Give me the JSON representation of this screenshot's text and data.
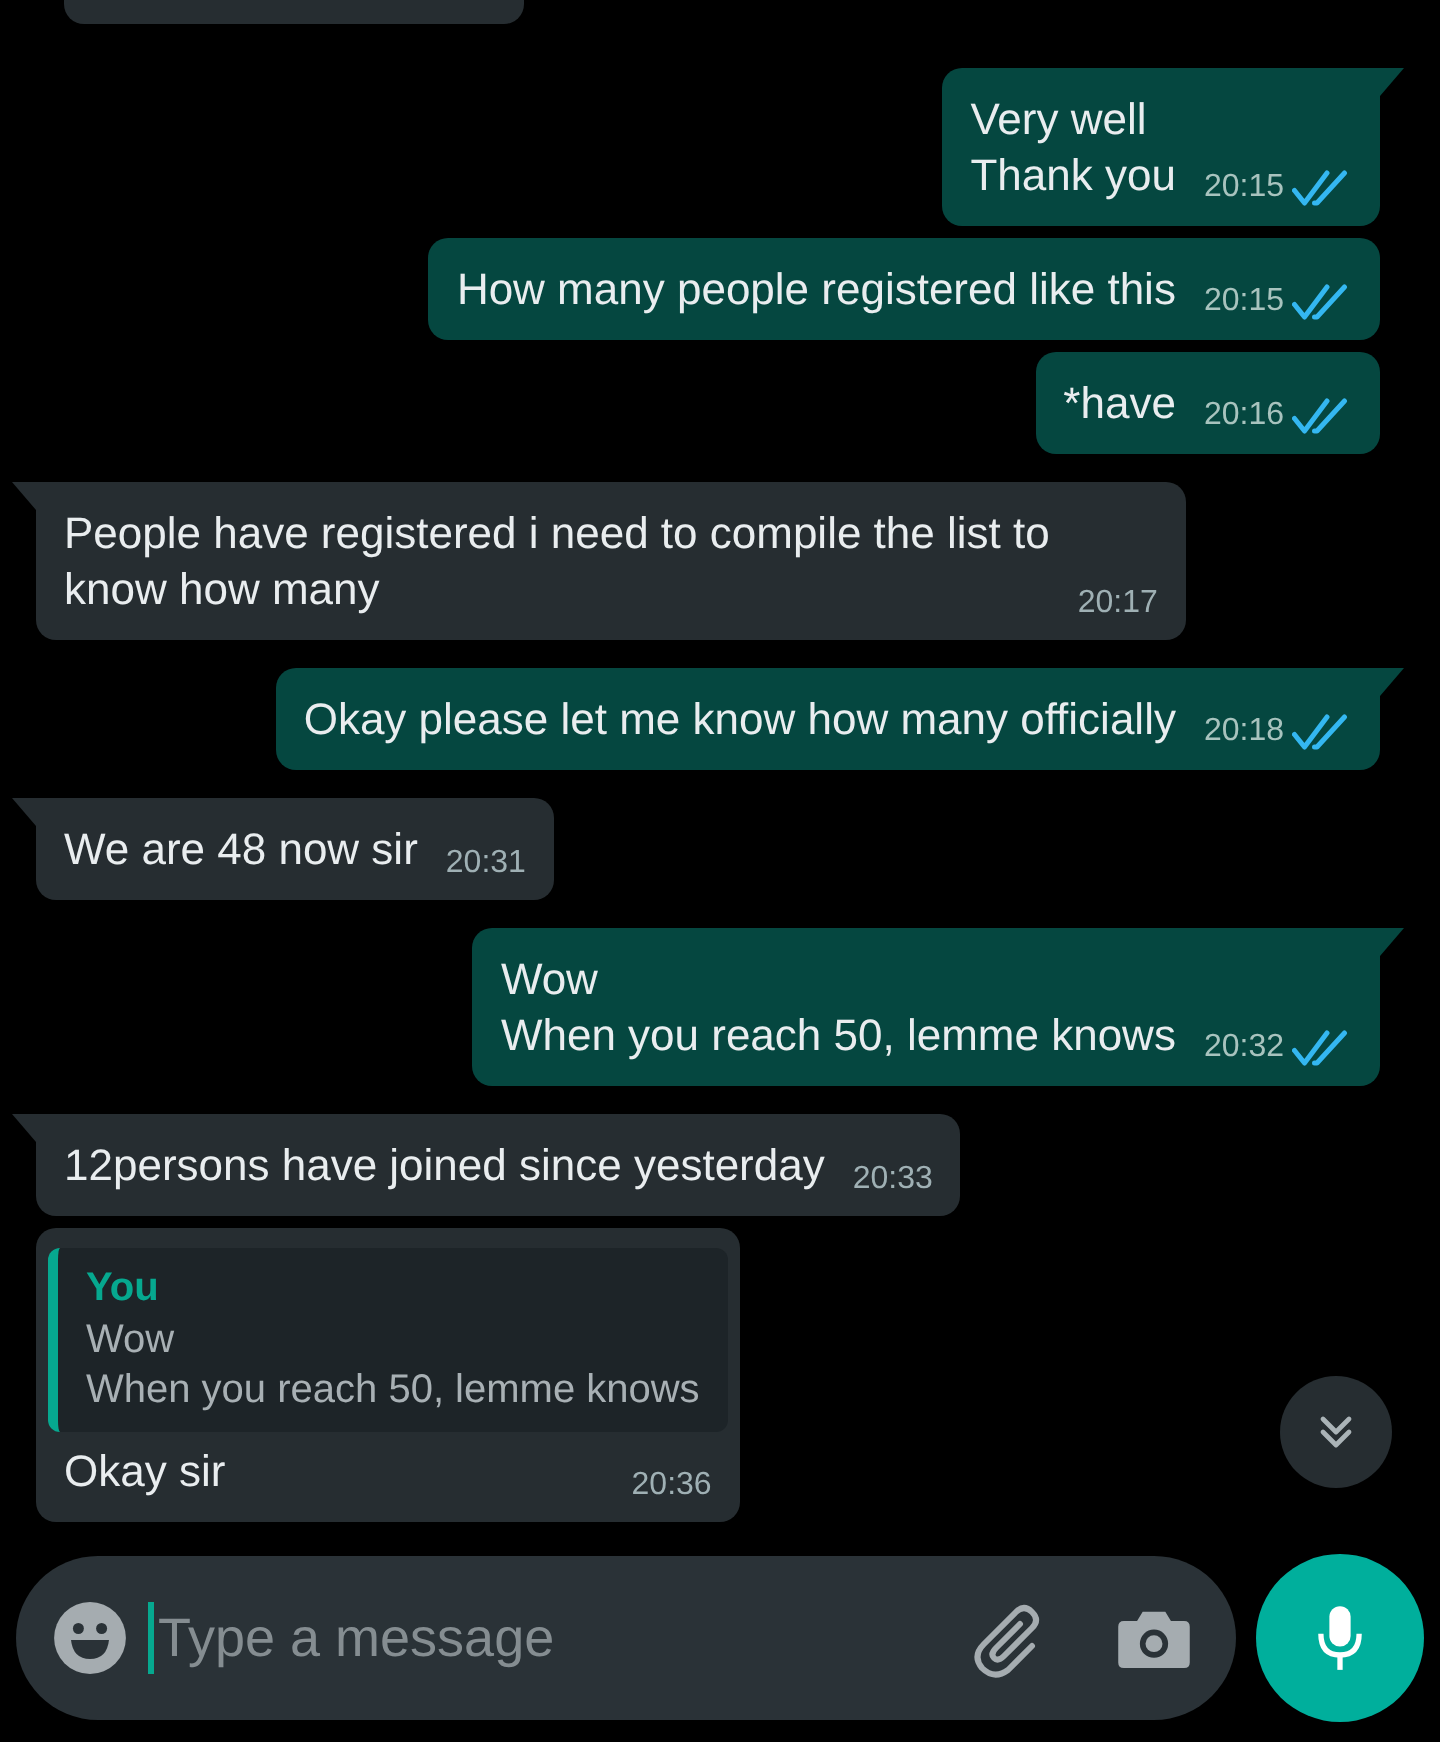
{
  "messages": [
    {
      "kind": "out",
      "text": "Very well\nThank you",
      "time": "20:15",
      "read": true,
      "tail": true
    },
    {
      "kind": "out",
      "text": "How many people registered like this",
      "time": "20:15",
      "read": true,
      "tail": false
    },
    {
      "kind": "out",
      "text": "*have",
      "time": "20:16",
      "read": true,
      "tail": false
    },
    {
      "kind": "in",
      "text": "People have registered i need to compile the list to\nknow how many",
      "time": "20:17",
      "tail": true
    },
    {
      "kind": "out",
      "text": "Okay please let me know how many officially",
      "time": "20:18",
      "read": true,
      "tail": true
    },
    {
      "kind": "in",
      "text": "We are 48 now sir",
      "time": "20:31",
      "tail": true
    },
    {
      "kind": "out",
      "text": "Wow\nWhen you reach 50, lemme knows",
      "time": "20:32",
      "read": true,
      "tail": true
    },
    {
      "kind": "in",
      "text": "12persons have joined since yesterday",
      "time": "20:33",
      "tail": true
    },
    {
      "kind": "in",
      "quote": {
        "author": "You",
        "text": "Wow\nWhen you reach 50, lemme knows"
      },
      "text": "Okay sir",
      "time": "20:36",
      "tail": false
    }
  ],
  "composer": {
    "placeholder": "Type a message"
  }
}
